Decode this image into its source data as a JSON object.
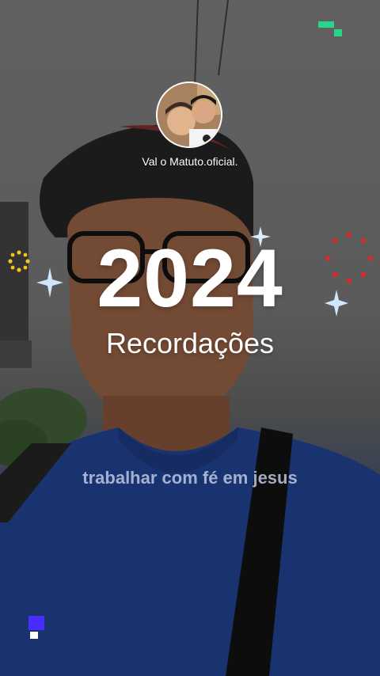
{
  "story": {
    "username": "Val o Matuto.oficial.",
    "year": "2024",
    "subtitle": "Recordações",
    "caption": "trabalhar com fé em jesus"
  },
  "colors": {
    "accent_green": "#27d68a",
    "accent_purple": "#4b2cff",
    "firework_red": "#e8242a",
    "firework_yellow": "#f2c61a",
    "sparkle": "#cfe6ff"
  }
}
